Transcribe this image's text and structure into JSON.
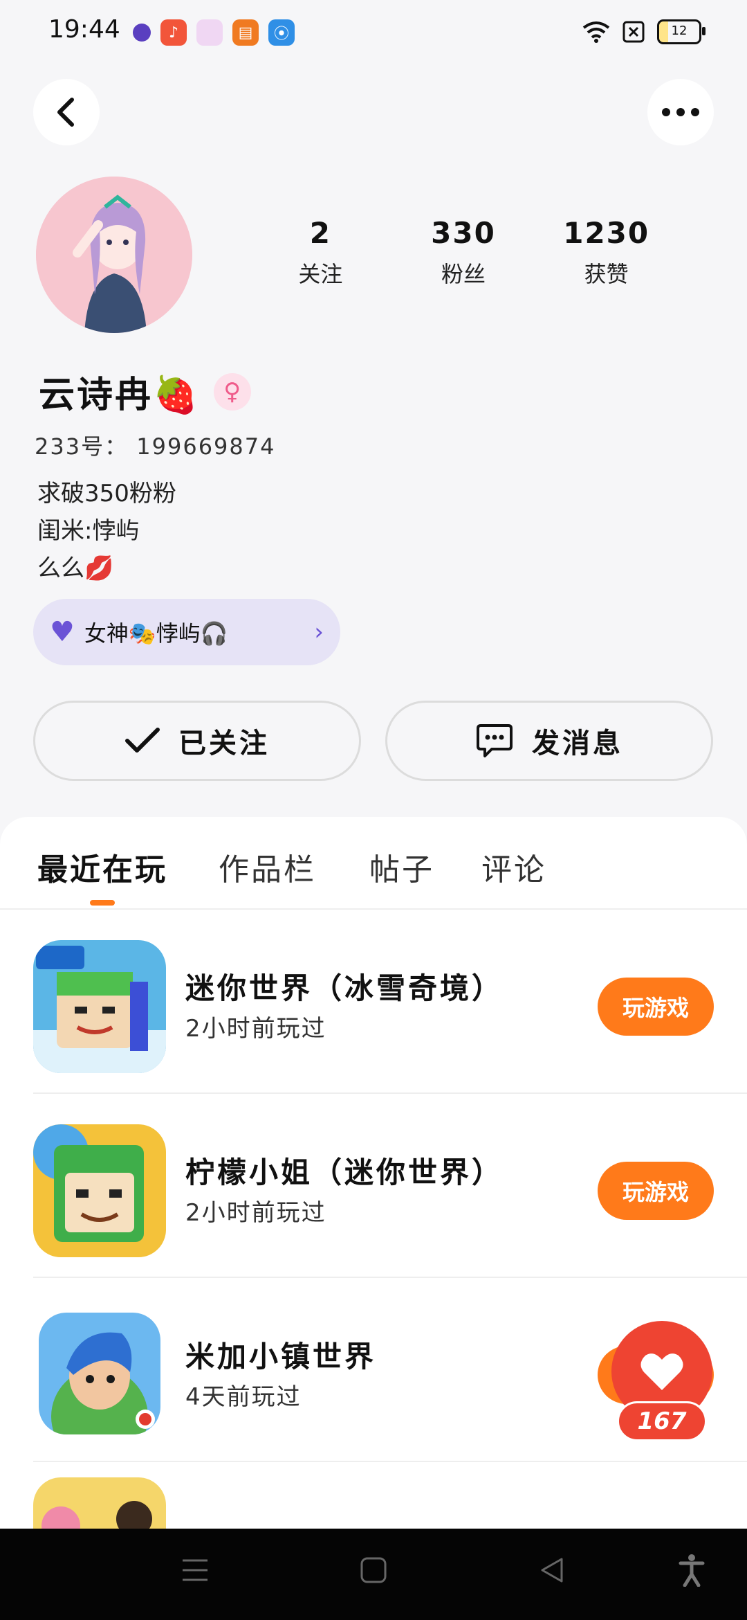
{
  "status_bar": {
    "time": "19:44",
    "battery": "12",
    "icons": [
      "app-icon-purple",
      "music-app-icon",
      "pink-app-icon",
      "book-app-icon",
      "radio-app-icon",
      "wifi-icon",
      "close-box-icon",
      "battery-icon"
    ]
  },
  "header": {
    "back_icon": "back-icon",
    "more_icon": "more-icon"
  },
  "profile": {
    "stats": [
      {
        "num": "2",
        "label": "关注"
      },
      {
        "num": "330",
        "label": "粉丝"
      },
      {
        "num": "1230",
        "label": "获赞"
      }
    ],
    "username": "云诗冉🍓",
    "gender_symbol": "♀",
    "id_line": "233号： 199669874",
    "bio_lines": [
      "求破350粉粉",
      "闺米:悖屿",
      "么么💋"
    ],
    "tag_text": "女神🎭悖屿🎧"
  },
  "actions": {
    "follow_label": "已关注",
    "message_label": "发消息"
  },
  "tabs": [
    "最近在玩",
    "作品栏",
    "帖子",
    "评论"
  ],
  "games": [
    {
      "title": "迷你世界（冰雪奇境）",
      "time": "2小时前玩过",
      "button": "玩游戏"
    },
    {
      "title": "柠檬小姐（迷你世界）",
      "time": "2小时前玩过",
      "button": "玩游戏"
    },
    {
      "title": "米加小镇世界",
      "time": "4天前玩过",
      "button": ""
    }
  ],
  "like_count": "167",
  "colors": {
    "accent": "#ff7a1a",
    "like": "#ee4432",
    "pill": "#e6e3f6"
  }
}
